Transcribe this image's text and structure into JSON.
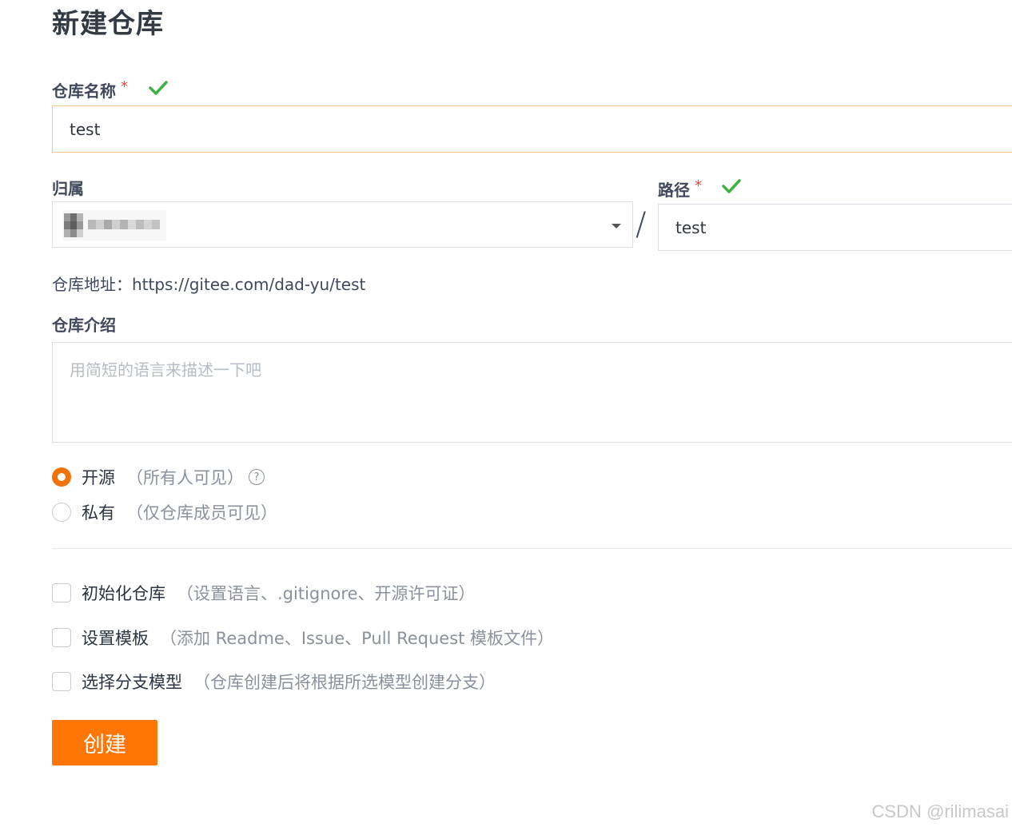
{
  "page": {
    "title": "新建仓库"
  },
  "repo_name": {
    "label": "仓库名称",
    "required_mark": "*",
    "value": "test"
  },
  "owner": {
    "label": "归属"
  },
  "separator": "/",
  "path": {
    "label": "路径",
    "required_mark": "*",
    "value": "test"
  },
  "address": {
    "prefix": "仓库地址：",
    "url": "https://gitee.com/dad-yu/test"
  },
  "description": {
    "label": "仓库介绍",
    "placeholder": "用简短的语言来描述一下吧"
  },
  "visibility": {
    "options": [
      {
        "label": "开源",
        "hint": "（所有人可见）",
        "selected": true
      },
      {
        "label": "私有",
        "hint": "（仅仓库成员可见）",
        "selected": false
      }
    ],
    "help_icon": "?"
  },
  "options": [
    {
      "label": "初始化仓库",
      "hint": "（设置语言、.gitignore、开源许可证）",
      "checked": false
    },
    {
      "label": "设置模板",
      "hint": "（添加 Readme、Issue、Pull Request 模板文件）",
      "checked": false
    },
    {
      "label": "选择分支模型",
      "hint": "（仓库创建后将根据所选模型创建分支）",
      "checked": false
    }
  ],
  "submit": {
    "label": "创建"
  },
  "watermark": "CSDN @rilimasai",
  "colors": {
    "accent": "#fd7606",
    "valid": "#3fb044",
    "required": "#f04134"
  }
}
